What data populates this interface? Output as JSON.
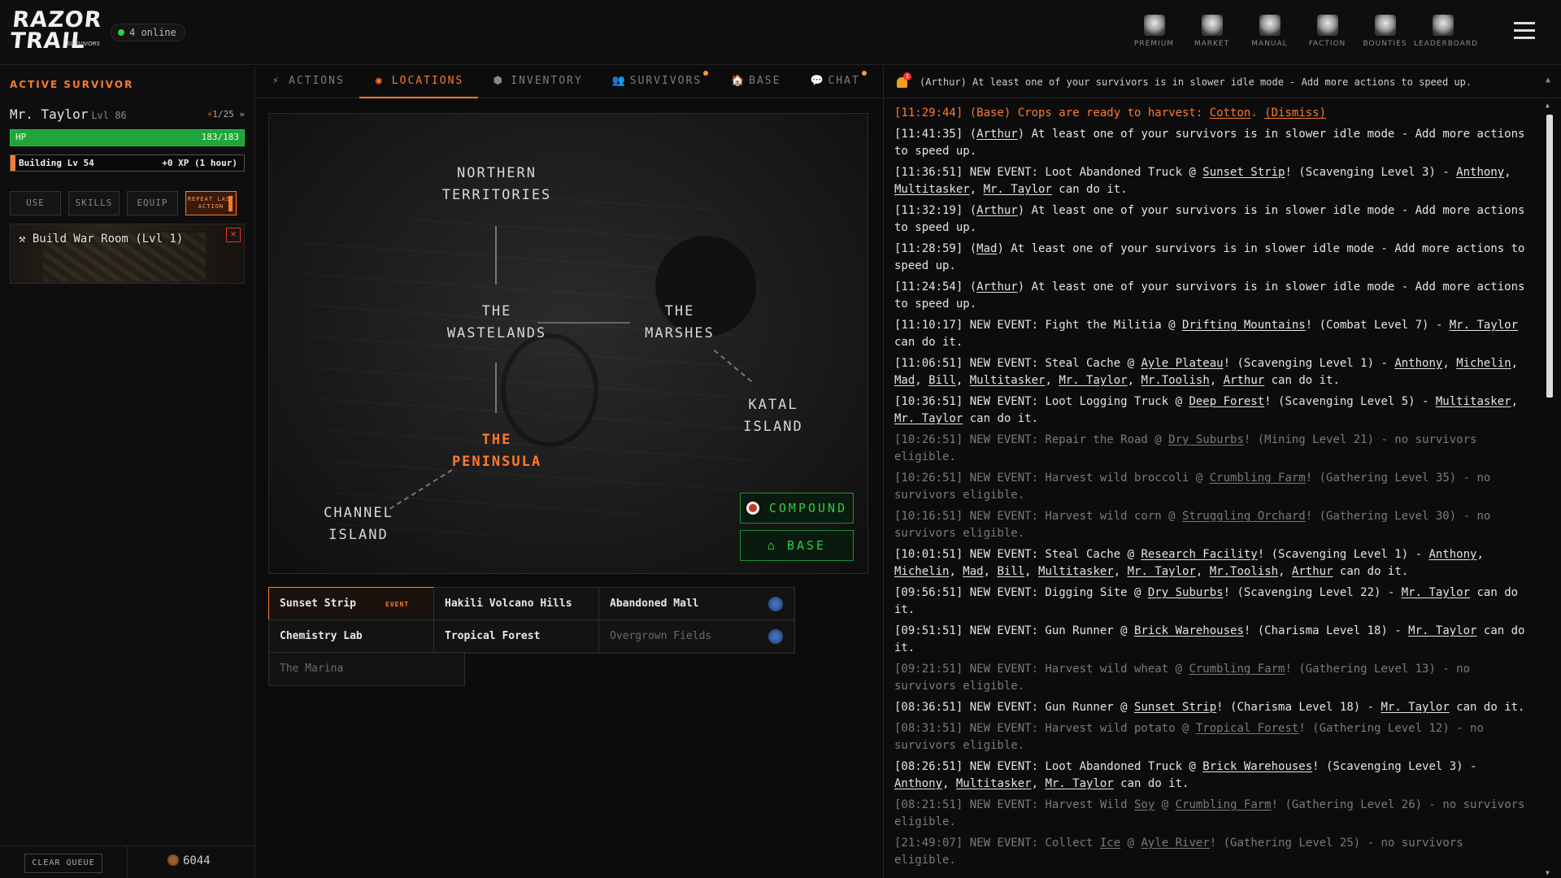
{
  "header": {
    "logo_text_1": "RAZOR",
    "logo_text_2": "TRAIL",
    "logo_sub": "SURVIVORS",
    "online_label": "4 online",
    "nav": [
      {
        "label": "PREMIUM",
        "icon": "premium-skull-icon"
      },
      {
        "label": "MARKET",
        "icon": "market-stall-icon"
      },
      {
        "label": "MANUAL",
        "icon": "manual-book-icon"
      },
      {
        "label": "FACTION",
        "icon": "faction-figure-icon"
      },
      {
        "label": "BOUNTIES",
        "icon": "bounties-skull-icon"
      },
      {
        "label": "LEADERBOARD",
        "icon": "leaderboard-trophy-icon"
      }
    ]
  },
  "survivor_panel": {
    "heading": "ACTIVE SURVIVOR",
    "name": "Mr. Taylor",
    "level": "Lvl 86",
    "energy": "1/25",
    "hp_label": "HP",
    "hp_value": "183/183",
    "hp_fraction": 1.0,
    "building_label": "Building Lv 54",
    "building_xp": "+0 XP (1 hour)",
    "building_fraction": 0.02,
    "buttons": {
      "use": "USE",
      "skills": "SKILLS",
      "equip": "EQUIP",
      "repeat": "REPEAT LAST ACTION"
    },
    "queue_item": "Build War Room (Lvl 1)",
    "clear_queue": "CLEAR QUEUE",
    "coins": "6044"
  },
  "tabs": [
    {
      "label": "ACTIONS",
      "icon": "⚡",
      "active": false,
      "notif": false
    },
    {
      "label": "LOCATIONS",
      "icon": "◉",
      "active": true,
      "notif": false
    },
    {
      "label": "INVENTORY",
      "icon": "⬢",
      "active": false,
      "notif": false
    },
    {
      "label": "SURVIVORS",
      "icon": "👥",
      "active": false,
      "notif": true
    },
    {
      "label": "BASE",
      "icon": "🏠",
      "active": false,
      "notif": false
    },
    {
      "label": "CHAT",
      "icon": "💬",
      "active": false,
      "notif": true
    }
  ],
  "map": {
    "regions": {
      "northern": "NORTHERN TERRITORIES",
      "wastelands": "THE WASTELANDS",
      "marshes": "THE MARSHES",
      "katal": "KATAL ISLAND",
      "peninsula": "THE PENINSULA",
      "channel": "CHANNEL ISLAND"
    },
    "current_region": "THE PENINSULA",
    "compound_button": "COMPOUND",
    "base_button": "⌂ BASE"
  },
  "locations": [
    {
      "name": "Sunset Strip",
      "tag": "EVENT",
      "icon": "orange",
      "selected": true,
      "dim": false
    },
    {
      "name": "Hakili Volcano Hills",
      "tag": "",
      "icon": "blue",
      "selected": false,
      "dim": false
    },
    {
      "name": "Abandoned Mall",
      "tag": "",
      "icon": "blue",
      "selected": false,
      "dim": false
    },
    {
      "name": "Chemistry Lab",
      "tag": "",
      "icon": "",
      "selected": false,
      "dim": false
    },
    {
      "name": "Tropical Forest",
      "tag": "",
      "icon": "red",
      "selected": false,
      "dim": false
    },
    {
      "name": "Overgrown Fields",
      "tag": "",
      "icon": "blue",
      "selected": false,
      "dim": true
    },
    {
      "name": "The Marina",
      "tag": "",
      "icon": "",
      "selected": false,
      "dim": true
    }
  ],
  "events_header": "(Arthur) At least one of your survivors is in slower idle mode - Add more actions to speed up.",
  "bell_count": "1",
  "events": [
    {
      "html": "[11:29:44] (Base) Crops are ready to harvest: <u>Cotton</u>. <u>(Dismiss)</u>",
      "style": "orange"
    },
    {
      "html": "[11:41:35] (<u>Arthur</u>) At least one of your survivors is in slower idle mode - Add more actions to speed up.",
      "style": ""
    },
    {
      "html": "[11:36:51] NEW EVENT: Loot Abandoned Truck @ <u>Sunset Strip</u>! (Scavenging Level 3) - <u>Anthony</u>, <u>Multitasker</u>, <u>Mr. Taylor</u> can do it.",
      "style": ""
    },
    {
      "html": "[11:32:19] (<u>Arthur</u>) At least one of your survivors is in slower idle mode - Add more actions to speed up.",
      "style": ""
    },
    {
      "html": "[11:28:59] (<u>Mad</u>) At least one of your survivors is in slower idle mode - Add more actions to speed up.",
      "style": ""
    },
    {
      "html": "[11:24:54] (<u>Arthur</u>) At least one of your survivors is in slower idle mode - Add more actions to speed up.",
      "style": ""
    },
    {
      "html": "[11:10:17] NEW EVENT: Fight the Militia @ <u>Drifting Mountains</u>! (Combat Level 7) - <u>Mr. Taylor</u> can do it.",
      "style": ""
    },
    {
      "html": "[11:06:51] NEW EVENT: Steal Cache @ <u>Ayle Plateau</u>! (Scavenging Level 1) - <u>Anthony</u>, <u>Michelin</u>, <u>Mad</u>, <u>Bill</u>, <u>Multitasker</u>, <u>Mr. Taylor</u>, <u>Mr.Toolish</u>, <u>Arthur</u> can do it.",
      "style": ""
    },
    {
      "html": "[10:36:51] NEW EVENT: Loot Logging Truck @ <u>Deep Forest</u>! (Scavenging Level 5) - <u>Multitasker</u>, <u>Mr. Taylor</u> can do it.",
      "style": ""
    },
    {
      "html": "[10:26:51] NEW EVENT: Repair the Road @ <u>Dry Suburbs</u>! (Mining Level 21) - no survivors eligible.",
      "style": "dim"
    },
    {
      "html": "[10:26:51] NEW EVENT: Harvest wild broccoli @ <u>Crumbling Farm</u>! (Gathering Level 35) - no survivors eligible.",
      "style": "dim"
    },
    {
      "html": "[10:16:51] NEW EVENT: Harvest wild corn @ <u>Struggling Orchard</u>! (Gathering Level 30) - no survivors eligible.",
      "style": "dim"
    },
    {
      "html": "[10:01:51] NEW EVENT: Steal Cache @ <u>Research Facility</u>! (Scavenging Level 1) - <u>Anthony</u>, <u>Michelin</u>, <u>Mad</u>, <u>Bill</u>, <u>Multitasker</u>, <u>Mr. Taylor</u>, <u>Mr.Toolish</u>, <u>Arthur</u> can do it.",
      "style": ""
    },
    {
      "html": "[09:56:51] NEW EVENT: Digging Site @ <u>Dry Suburbs</u>! (Scavenging Level 22) - <u>Mr. Taylor</u> can do it.",
      "style": ""
    },
    {
      "html": "[09:51:51] NEW EVENT: Gun Runner @ <u>Brick Warehouses</u>! (Charisma Level 18) - <u>Mr. Taylor</u> can do it.",
      "style": ""
    },
    {
      "html": "[09:21:51] NEW EVENT: Harvest wild wheat @ <u>Crumbling Farm</u>! (Gathering Level 13) - no survivors eligible.",
      "style": "dim"
    },
    {
      "html": "[08:36:51] NEW EVENT: Gun Runner @ <u>Sunset Strip</u>! (Charisma Level 18) - <u>Mr. Taylor</u> can do it.",
      "style": ""
    },
    {
      "html": "[08:31:51] NEW EVENT: Harvest wild potato @ <u>Tropical Forest</u>! (Gathering Level 12) - no survivors eligible.",
      "style": "dim"
    },
    {
      "html": "[08:26:51] NEW EVENT: Loot Abandoned Truck @ <u>Brick Warehouses</u>! (Scavenging Level 3) - <u>Anthony</u>, <u>Multitasker</u>, <u>Mr. Taylor</u> can do it.",
      "style": ""
    },
    {
      "html": "[08:21:51] NEW EVENT: Harvest Wild <u>Soy</u> @ <u>Crumbling Farm</u>! (Gathering Level 26) - no survivors eligible.",
      "style": "dim"
    },
    {
      "html": "[21:49:07] NEW EVENT: Collect <u>Ice</u> @ <u>Ayle River</u>! (Gathering Level 25) - no survivors eligible.",
      "style": "dim"
    }
  ],
  "colors": {
    "accent": "#ff7a2e",
    "hp": "#1fa53c",
    "online": "#2ecc40"
  }
}
